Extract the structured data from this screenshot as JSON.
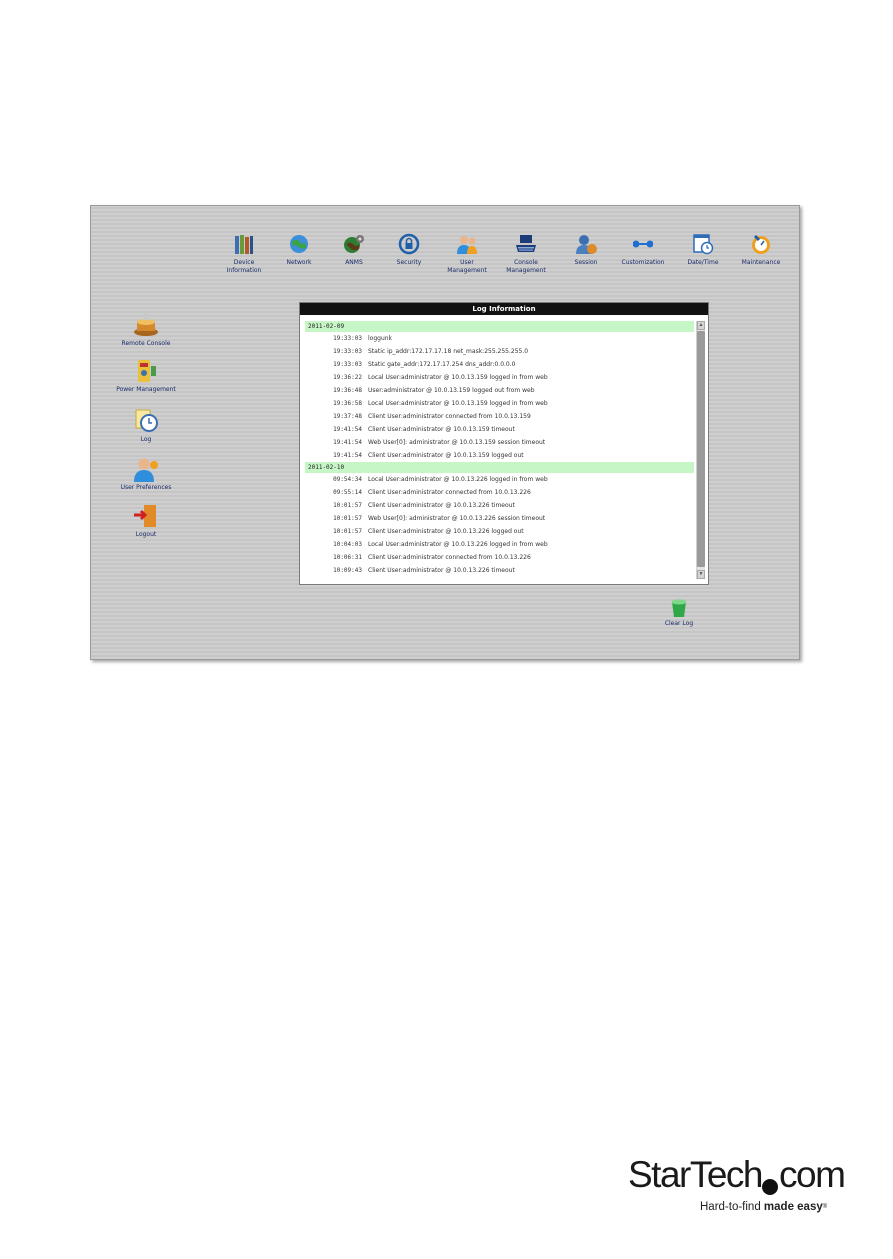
{
  "toolbar": {
    "items": [
      {
        "label": "Device\nInformation",
        "icon": "books-icon",
        "color": "#3b6fb0"
      },
      {
        "label": "Network",
        "icon": "globe-network-icon",
        "color": "#2f9a3a"
      },
      {
        "label": "ANMS",
        "icon": "globe-gear-icon",
        "color": "#2e7d32"
      },
      {
        "label": "Security",
        "icon": "padlock-icon",
        "color": "#1f5fa8"
      },
      {
        "label": "User\nManagement",
        "icon": "users-icon",
        "color": "#2f8fdc"
      },
      {
        "label": "Console\nManagement",
        "icon": "keyboard-icon",
        "color": "#1d3d78"
      },
      {
        "label": "Session",
        "icon": "user-session-icon",
        "color": "#e08a2a"
      },
      {
        "label": "Customization",
        "icon": "wrench-icon",
        "color": "#1f6fd0"
      },
      {
        "label": "Date/Time",
        "icon": "calendar-clock-icon",
        "color": "#2f6db8"
      },
      {
        "label": "Maintenance",
        "icon": "maintenance-icon",
        "color": "#f0a020"
      }
    ]
  },
  "sidebar": {
    "items": [
      {
        "label": "Remote Console",
        "icon": "remote-console-icon"
      },
      {
        "label": "Power Management",
        "icon": "power-management-icon"
      },
      {
        "label": "Log",
        "icon": "log-clock-icon"
      },
      {
        "label": "User Preferences",
        "icon": "user-preferences-icon"
      },
      {
        "label": "Logout",
        "icon": "logout-door-icon"
      }
    ]
  },
  "log": {
    "title": "Log Information",
    "groups": [
      {
        "date": "2011-02-09",
        "entries": [
          {
            "time": "19:33:03",
            "message": "loggunk"
          },
          {
            "time": "19:33:03",
            "message": "Static ip_addr:172.17.17.18 net_mask:255.255.255.0"
          },
          {
            "time": "19:33:03",
            "message": "Static gate_addr:172.17.17.254 dns_addr:0.0.0.0"
          },
          {
            "time": "19:36:22",
            "message": "Local User:administrator @ 10.0.13.159 logged in from web"
          },
          {
            "time": "19:36:48",
            "message": "User:administrator @ 10.0.13.159 logged out from web"
          },
          {
            "time": "19:36:58",
            "message": "Local User:administrator @ 10.0.13.159 logged in from web"
          },
          {
            "time": "19:37:48",
            "message": "Client User:administrator connected from 10.0.13.159"
          },
          {
            "time": "19:41:54",
            "message": "Client User:administrator @ 10.0.13.159 timeout"
          },
          {
            "time": "19:41:54",
            "message": "Web User[0]: administrator @ 10.0.13.159 session timeout"
          },
          {
            "time": "19:41:54",
            "message": "Client User:administrator @ 10.0.13.159 logged out"
          }
        ]
      },
      {
        "date": "2011-02-10",
        "entries": [
          {
            "time": "09:54:34",
            "message": "Local User:administrator @ 10.0.13.226 logged in from web"
          },
          {
            "time": "09:55:14",
            "message": "Client User:administrator connected from 10.0.13.226"
          },
          {
            "time": "10:01:57",
            "message": "Client User:administrator @ 10.0.13.226 timeout"
          },
          {
            "time": "10:01:57",
            "message": "Web User[0]: administrator @ 10.0.13.226 session timeout"
          },
          {
            "time": "10:01:57",
            "message": "Client User:administrator @ 10.0.13.226 logged out"
          },
          {
            "time": "10:04:03",
            "message": "Local User:administrator @ 10.0.13.226 logged in from web"
          },
          {
            "time": "10:06:31",
            "message": "Client User:administrator connected from 10.0.13.226"
          },
          {
            "time": "10:09:43",
            "message": "Client User:administrator @ 10.0.13.226 timeout"
          }
        ]
      }
    ]
  },
  "actions": {
    "clear_log_label": "Clear Log"
  },
  "brand": {
    "name": "StarTech",
    "suffix": "com",
    "tagline_prefix": "Hard-to-find ",
    "tagline_bold": "made easy",
    "registered": "®"
  }
}
